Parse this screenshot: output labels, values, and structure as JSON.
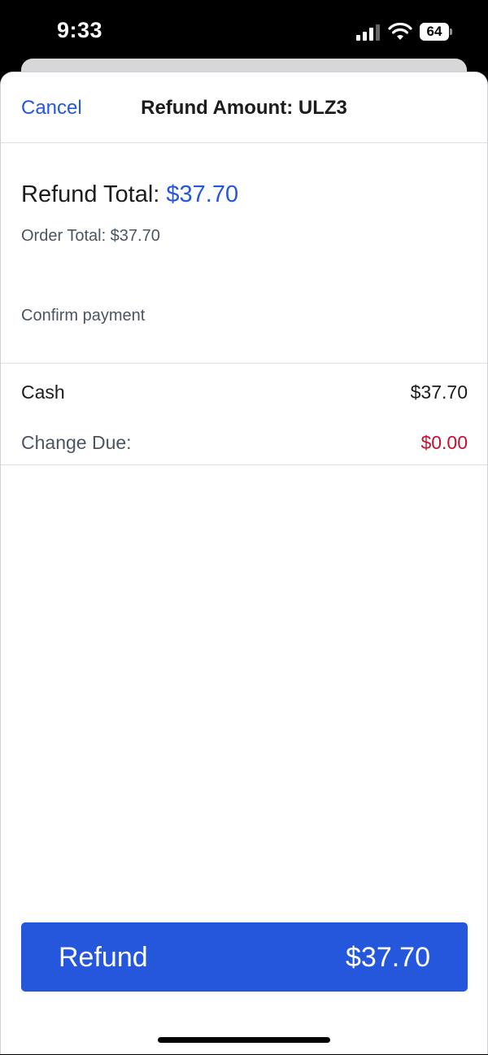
{
  "status_bar": {
    "time": "9:33",
    "battery_level": "64"
  },
  "nav": {
    "cancel_label": "Cancel",
    "title": "Refund Amount: ULZ3"
  },
  "summary": {
    "refund_total_label": "Refund Total: ",
    "refund_total_value": "$37.70",
    "order_total": "Order Total: $37.70",
    "confirm_label": "Confirm payment"
  },
  "payment": {
    "cash_label": "Cash",
    "cash_value": "$37.70",
    "change_label": "Change Due:",
    "change_value": "$0.00"
  },
  "refund_button": {
    "label": "Refund",
    "amount": "$37.70"
  },
  "colors": {
    "accent": "#2457dc",
    "change_due": "#c8102e"
  }
}
